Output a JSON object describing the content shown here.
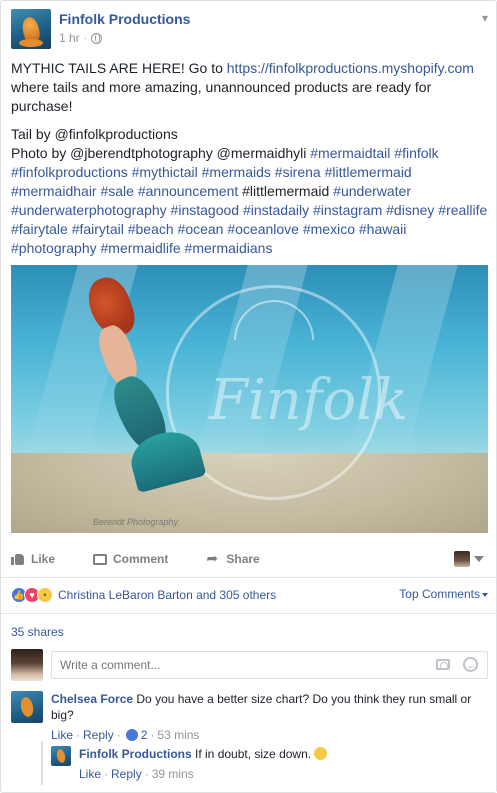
{
  "post": {
    "page_name": "Finfolk Productions",
    "time": "1 hr",
    "dot": "·",
    "intro_1": "MYTHIC TAILS ARE HERE! Go to ",
    "url": "https://finfolkproductions.myshopify.com",
    "intro_2": " where tails and more amazing, unannounced products are ready for purchase!",
    "tail_by": "Tail by @finfolkproductions",
    "photo_by": "Photo by @jberendtphotography @mermaidhyli ",
    "hashtags_1": "#mermaidtail #finfolk #finfolkproductions #mythictail #mermaids #sirena #littlemermaid #mermaidhair #sale #announcement ",
    "plain_tag": "#littlemermaid",
    "hashtags_2": " #underwater #underwaterphotography #instagood #instadaily #instagram #disney #reallife #fairytale #fairytail #beach #ocean #oceanlove #mexico #hawaii #photography #mermaidlife #mermaidians",
    "photo_credit": "Berendt Photography"
  },
  "actions": {
    "like": "Like",
    "comment": "Comment",
    "share": "Share"
  },
  "reactions": {
    "names": "Christina LeBaron Barton and 305 others",
    "sort": "Top Comments"
  },
  "shares": "35 shares",
  "composer": {
    "placeholder": "Write a comment..."
  },
  "comments": [
    {
      "author": "Chelsea Force",
      "text": "Do you have a better size chart? Do you think they run small or big?",
      "like": "Like",
      "reply": "Reply",
      "like_count": "2",
      "time": "53 mins"
    },
    {
      "author": "Finfolk Productions",
      "text": "If in doubt, size down.",
      "like": "Like",
      "reply": "Reply",
      "time": "39 mins"
    }
  ],
  "colors": {
    "link": "#365899",
    "like_reaction": "#4a76d9",
    "love_reaction": "#f0416e"
  }
}
